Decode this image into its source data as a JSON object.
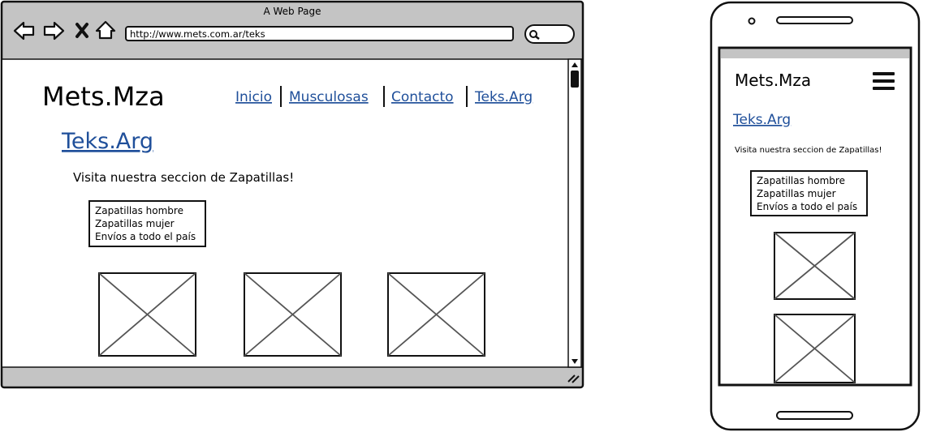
{
  "browser": {
    "window_title": "A Web Page",
    "url": "http://www.mets.com.ar/teks",
    "icons": [
      "back-arrow-icon",
      "forward-arrow-icon",
      "close-x-icon",
      "home-icon",
      "search-icon"
    ],
    "site": {
      "logo": "Mets.Mza",
      "nav": [
        "Inicio",
        "Musculosas",
        "Contacto",
        "Teks.Arg"
      ],
      "heading": "Teks.Arg",
      "intro": "Visita nuestra seccion de Zapatillas!",
      "list": [
        "Zapatillas hombre",
        "Zapatillas mujer",
        "Envíos a todo el país"
      ],
      "images": [
        "image-placeholder",
        "image-placeholder",
        "image-placeholder"
      ]
    }
  },
  "phone": {
    "logo": "Mets.Mza",
    "menu_icon": "hamburger-menu-icon",
    "heading": "Teks.Arg",
    "intro": "Visita nuestra seccion de Zapatillas!",
    "list": [
      "Zapatillas hombre",
      "Zapatillas mujer",
      "Envíos a todo el país"
    ],
    "images": [
      "image-placeholder",
      "image-placeholder"
    ]
  },
  "colors": {
    "link": "#1f4f9a",
    "chrome": "#c4c4c4",
    "stroke": "#111111",
    "placeholder": "#555555"
  }
}
